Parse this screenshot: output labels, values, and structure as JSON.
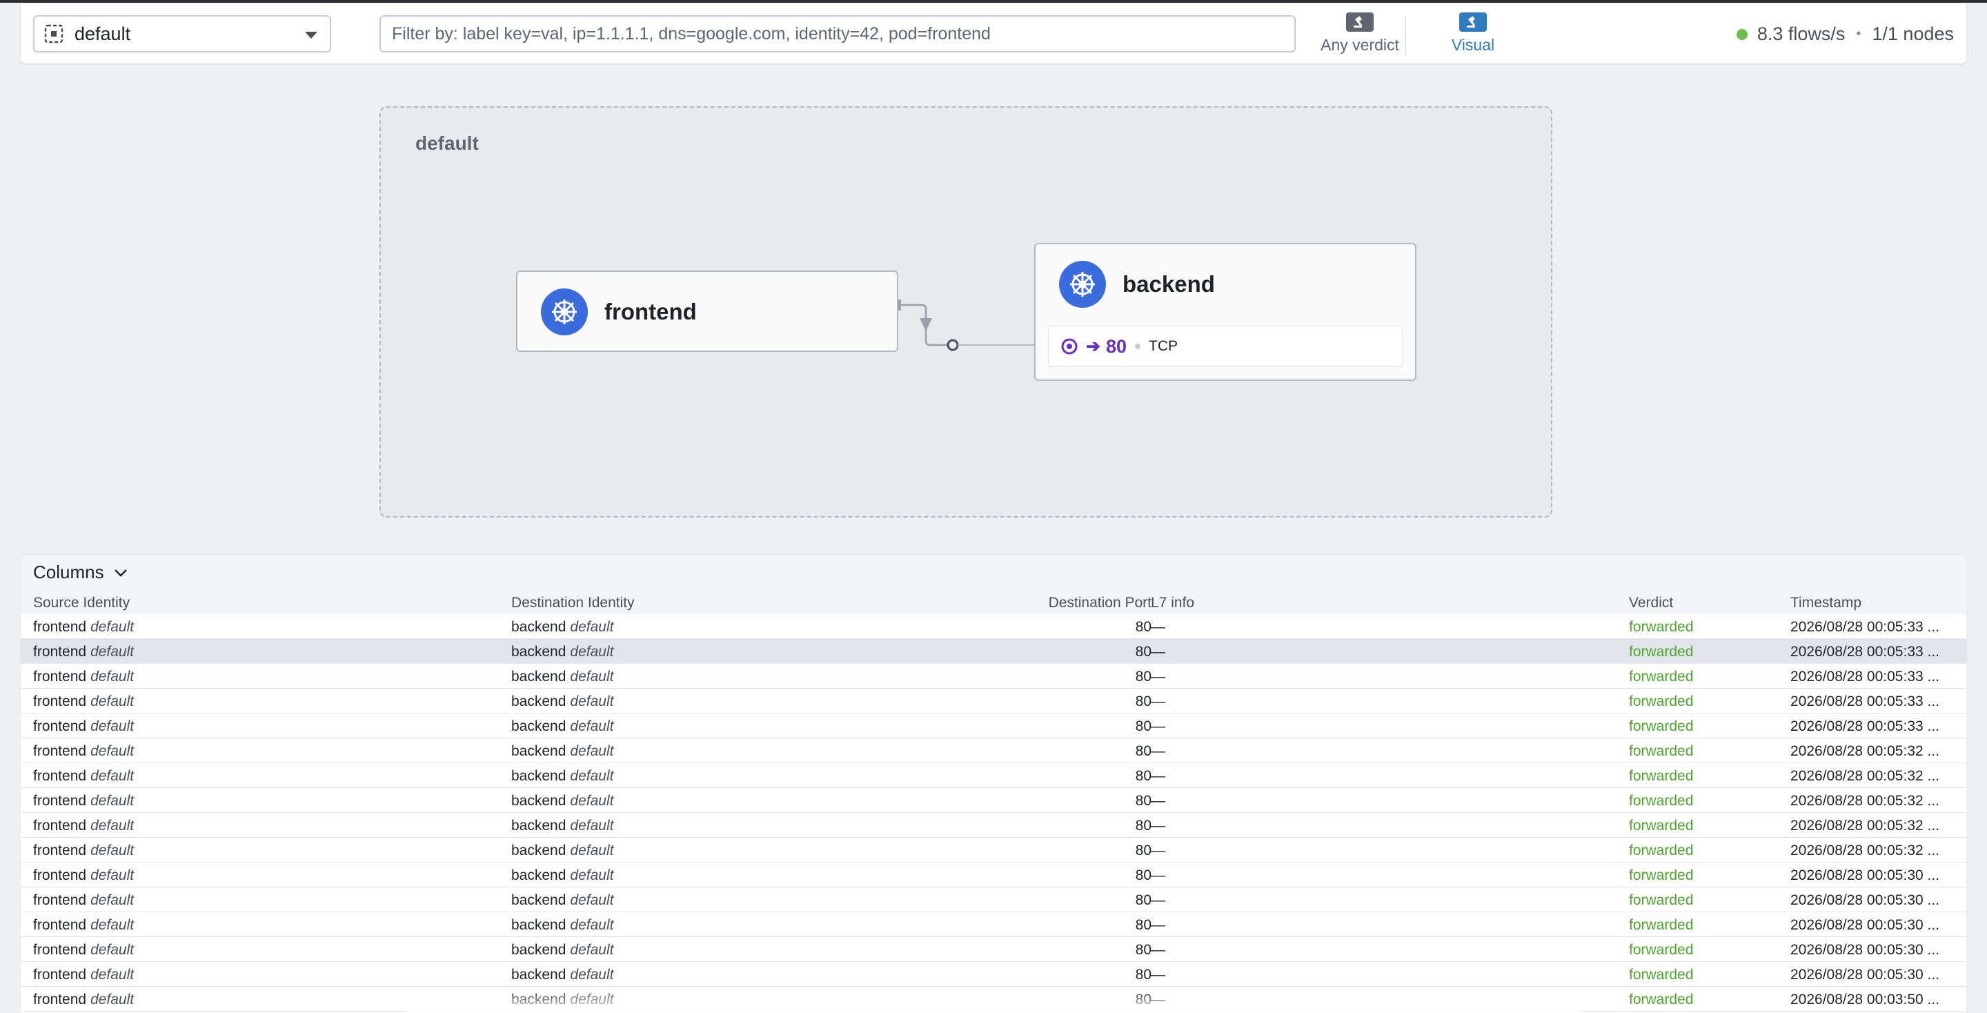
{
  "topbar": {
    "namespace": "default",
    "filter_placeholder": "Filter by: label key=val, ip=1.1.1.1, dns=google.com, identity=42, pod=frontend",
    "verdict_label": "Any verdict",
    "visual_label": "Visual",
    "flows_rate": "8.3 flows/s",
    "separator": "•",
    "nodes": "1/1 nodes",
    "status_color": "#6cbd49"
  },
  "map": {
    "namespace_title": "default",
    "frontend": {
      "name": "frontend",
      "icon": "kubernetes-icon"
    },
    "backend": {
      "name": "backend",
      "icon": "kubernetes-icon",
      "port_arrow": "➔",
      "port": "80",
      "protocol": "TCP"
    }
  },
  "table": {
    "columns_label": "Columns",
    "headers": {
      "source": "Source Identity",
      "destination": "Destination Identity",
      "port": "Destination Port",
      "l7": "L7 info",
      "verdict": "Verdict",
      "timestamp": "Timestamp"
    },
    "selected_row": 1,
    "rows": [
      {
        "src": "frontend",
        "src_ns": "default",
        "dst": "backend",
        "dst_ns": "default",
        "port": "80",
        "l7": "—",
        "verdict": "forwarded",
        "ts": "2026/08/28 00:05:33 ..."
      },
      {
        "src": "frontend",
        "src_ns": "default",
        "dst": "backend",
        "dst_ns": "default",
        "port": "80",
        "l7": "—",
        "verdict": "forwarded",
        "ts": "2026/08/28 00:05:33 ..."
      },
      {
        "src": "frontend",
        "src_ns": "default",
        "dst": "backend",
        "dst_ns": "default",
        "port": "80",
        "l7": "—",
        "verdict": "forwarded",
        "ts": "2026/08/28 00:05:33 ..."
      },
      {
        "src": "frontend",
        "src_ns": "default",
        "dst": "backend",
        "dst_ns": "default",
        "port": "80",
        "l7": "—",
        "verdict": "forwarded",
        "ts": "2026/08/28 00:05:33 ..."
      },
      {
        "src": "frontend",
        "src_ns": "default",
        "dst": "backend",
        "dst_ns": "default",
        "port": "80",
        "l7": "—",
        "verdict": "forwarded",
        "ts": "2026/08/28 00:05:33 ..."
      },
      {
        "src": "frontend",
        "src_ns": "default",
        "dst": "backend",
        "dst_ns": "default",
        "port": "80",
        "l7": "—",
        "verdict": "forwarded",
        "ts": "2026/08/28 00:05:32 ..."
      },
      {
        "src": "frontend",
        "src_ns": "default",
        "dst": "backend",
        "dst_ns": "default",
        "port": "80",
        "l7": "—",
        "verdict": "forwarded",
        "ts": "2026/08/28 00:05:32 ..."
      },
      {
        "src": "frontend",
        "src_ns": "default",
        "dst": "backend",
        "dst_ns": "default",
        "port": "80",
        "l7": "—",
        "verdict": "forwarded",
        "ts": "2026/08/28 00:05:32 ..."
      },
      {
        "src": "frontend",
        "src_ns": "default",
        "dst": "backend",
        "dst_ns": "default",
        "port": "80",
        "l7": "—",
        "verdict": "forwarded",
        "ts": "2026/08/28 00:05:32 ..."
      },
      {
        "src": "frontend",
        "src_ns": "default",
        "dst": "backend",
        "dst_ns": "default",
        "port": "80",
        "l7": "—",
        "verdict": "forwarded",
        "ts": "2026/08/28 00:05:32 ..."
      },
      {
        "src": "frontend",
        "src_ns": "default",
        "dst": "backend",
        "dst_ns": "default",
        "port": "80",
        "l7": "—",
        "verdict": "forwarded",
        "ts": "2026/08/28 00:05:30 ..."
      },
      {
        "src": "frontend",
        "src_ns": "default",
        "dst": "backend",
        "dst_ns": "default",
        "port": "80",
        "l7": "—",
        "verdict": "forwarded",
        "ts": "2026/08/28 00:05:30 ..."
      },
      {
        "src": "frontend",
        "src_ns": "default",
        "dst": "backend",
        "dst_ns": "default",
        "port": "80",
        "l7": "—",
        "verdict": "forwarded",
        "ts": "2026/08/28 00:05:30 ..."
      },
      {
        "src": "frontend",
        "src_ns": "default",
        "dst": "backend",
        "dst_ns": "default",
        "port": "80",
        "l7": "—",
        "verdict": "forwarded",
        "ts": "2026/08/28 00:05:30 ..."
      },
      {
        "src": "frontend",
        "src_ns": "default",
        "dst": "backend",
        "dst_ns": "default",
        "port": "80",
        "l7": "—",
        "verdict": "forwarded",
        "ts": "2026/08/28 00:05:30 ..."
      },
      {
        "src": "frontend",
        "src_ns": "default",
        "dst": "backend",
        "dst_ns": "default",
        "port": "80",
        "l7": "—",
        "verdict": "forwarded",
        "ts": "2026/08/28 00:03:50 ..."
      }
    ]
  },
  "colors": {
    "accent": "#2f7ac0",
    "verdict_forwarded": "#4fa62f",
    "port_purple": "#6a2fbf",
    "k8s_blue": "#3b6cde"
  }
}
